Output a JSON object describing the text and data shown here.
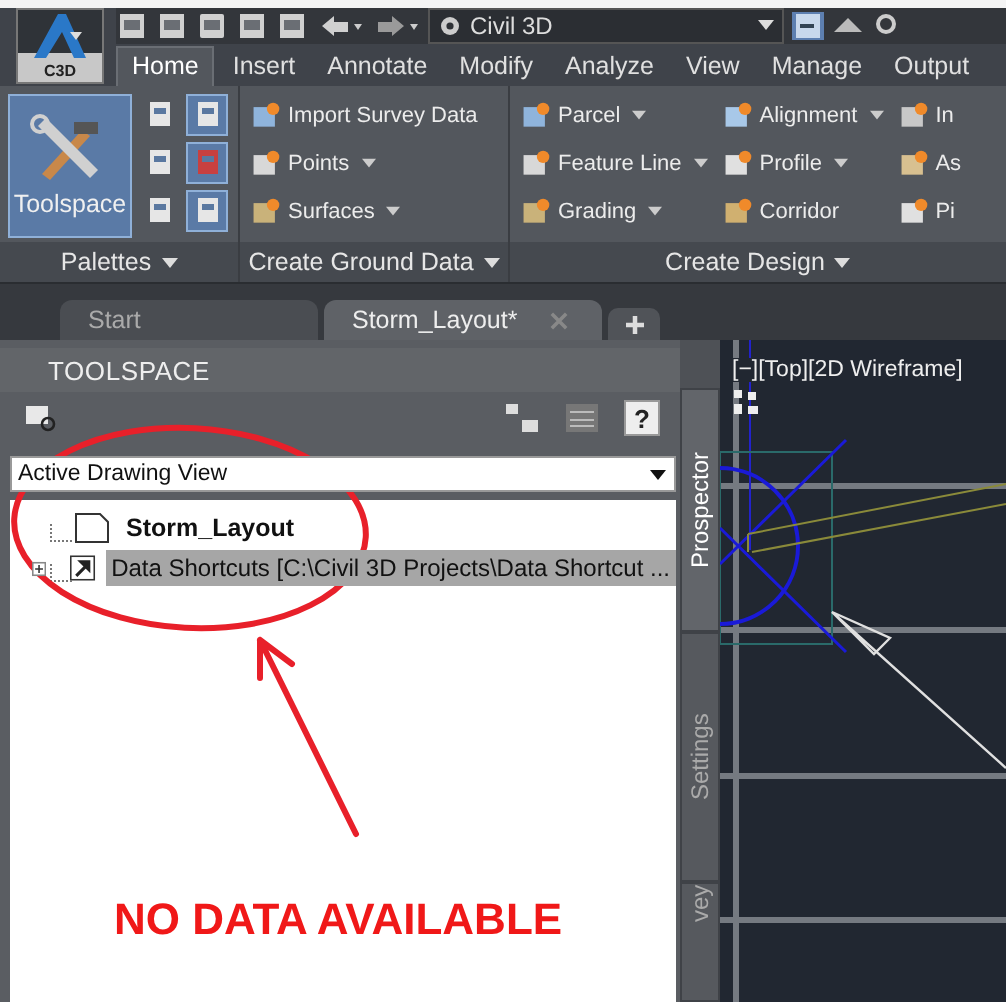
{
  "app_button": {
    "label": "C3D"
  },
  "workspace": {
    "value": "Civil 3D"
  },
  "ribbon_tabs": [
    {
      "label": "Home",
      "selected": true
    },
    {
      "label": "Insert",
      "selected": false
    },
    {
      "label": "Annotate",
      "selected": false
    },
    {
      "label": "Modify",
      "selected": false
    },
    {
      "label": "Analyze",
      "selected": false
    },
    {
      "label": "View",
      "selected": false
    },
    {
      "label": "Manage",
      "selected": false
    },
    {
      "label": "Output",
      "selected": false
    }
  ],
  "ribbon_panels": [
    {
      "kind": "palettes",
      "title": "Palettes",
      "big_button": "Toolspace"
    },
    {
      "kind": "buttons",
      "title": "Create Ground Data",
      "items": [
        {
          "label": "Import Survey Data",
          "dropdown": false
        },
        {
          "label": "Points",
          "dropdown": true
        },
        {
          "label": "Surfaces",
          "dropdown": true
        }
      ]
    },
    {
      "kind": "buttons",
      "title": "Create Design",
      "items": [
        {
          "label": "Parcel",
          "dropdown": true
        },
        {
          "label": "Feature Line",
          "dropdown": true
        },
        {
          "label": "Grading",
          "dropdown": true
        },
        {
          "label": "Alignment",
          "dropdown": true
        },
        {
          "label": "Profile",
          "dropdown": true
        },
        {
          "label": "Corridor",
          "dropdown": false
        },
        {
          "label": "In",
          "dropdown": false
        },
        {
          "label": "As",
          "dropdown": false
        },
        {
          "label": "Pi",
          "dropdown": false
        }
      ]
    }
  ],
  "document_tabs": [
    {
      "label": "Start",
      "selected": false
    },
    {
      "label": "Storm_Layout*",
      "selected": true
    }
  ],
  "toolspace": {
    "title": "TOOLSPACE",
    "help_label": "?",
    "view": "Active Drawing View",
    "tree": [
      {
        "label": "Storm_Layout",
        "kind": "drawing",
        "expandable": false,
        "selected": false
      },
      {
        "label": "Data Shortcuts [C:\\Civil 3D Projects\\Data Shortcut ...",
        "kind": "shortcuts",
        "expandable": true,
        "selected": true
      }
    ],
    "side_tabs": [
      {
        "label": "Prospector",
        "selected": true
      },
      {
        "label": "Settings",
        "selected": false
      },
      {
        "label": "vey",
        "selected": false
      }
    ]
  },
  "viewport": {
    "label": "[−][Top][2D Wireframe]"
  },
  "annotation": {
    "text": "NO DATA AVAILABLE"
  }
}
